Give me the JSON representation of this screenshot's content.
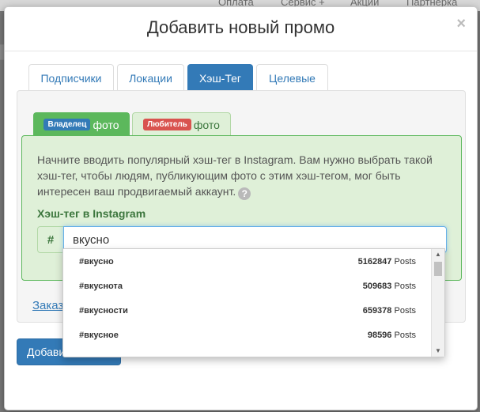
{
  "background_nav": [
    "Оплата",
    "Сервис +",
    "Акции",
    "Партнерка"
  ],
  "modal": {
    "title": "Добавить новый промо",
    "close": "×"
  },
  "tabs": [
    {
      "label": "Подписчики",
      "active": false
    },
    {
      "label": "Локации",
      "active": false
    },
    {
      "label": "Хэш-Тег",
      "active": true
    },
    {
      "label": "Целевые",
      "active": false
    }
  ],
  "subtabs": {
    "owner": {
      "badge": "Владелец",
      "text": "фото",
      "active": true
    },
    "fan": {
      "badge": "Любитель",
      "text": "фото",
      "active": false
    }
  },
  "description": "Начните вводить популярный хэш-тег в Instagram. Вам нужно выбрать такой хэш-тег, чтобы людям, публикующим фото с этим хэш-тегом, мог быть интересен ваш продвигаемый аккаунт.",
  "help_icon": "?",
  "field": {
    "label": "Хэш-тег в Instagram",
    "addon": "#",
    "value": "вкусно"
  },
  "order_link": "Заказ",
  "add_button": "Добави",
  "suggestions": [
    {
      "tag": "#вкусно",
      "count": "5162847",
      "unit": "Posts"
    },
    {
      "tag": "#вкуснота",
      "count": "509683",
      "unit": "Posts"
    },
    {
      "tag": "#вкусности",
      "count": "659378",
      "unit": "Posts"
    },
    {
      "tag": "#вкусное",
      "count": "98596",
      "unit": "Posts"
    }
  ],
  "scroll": {
    "up": "▲",
    "down": "▼"
  }
}
